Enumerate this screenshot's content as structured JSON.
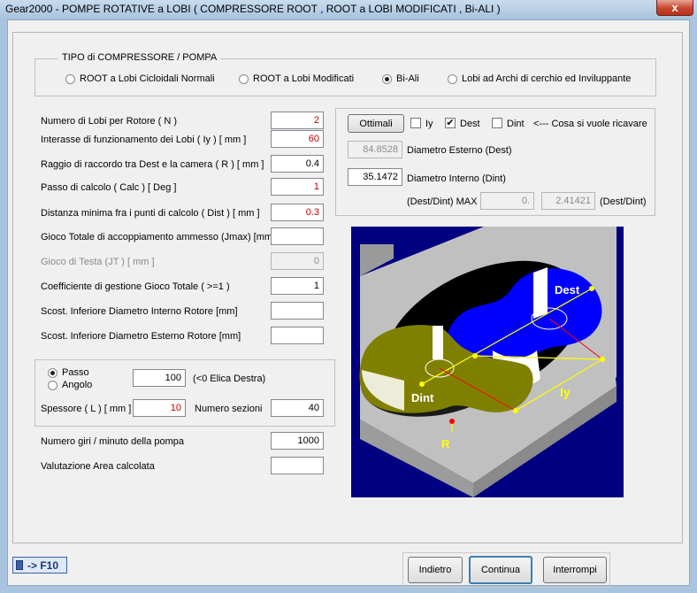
{
  "window": {
    "title": "Gear2000 - POMPE ROTATIVE a LOBI ( COMPRESSORE ROOT , ROOT a LOBI MODIFICATI , Bi-ALI )",
    "close_label": "x"
  },
  "tipo": {
    "label": "TIPO di COMPRESSORE / POMPA",
    "options": [
      "ROOT a Lobi Cicloidali Normali",
      "ROOT a Lobi Modificati",
      "Bi-Ali",
      "Lobi ad Archi di cerchio ed Inviluppante"
    ],
    "selected": "Bi-Ali"
  },
  "params": [
    {
      "label": "Numero di Lobi per Rotore ( N )",
      "value": "2",
      "red": true
    },
    {
      "label": "Interasse di funzionamento dei Lobi ( Iy ) [ mm ]",
      "value": "60",
      "red": true
    },
    {
      "label": "Raggio di raccordo tra Dest e la camera ( R ) [ mm ]",
      "value": "0.4",
      "red": false
    },
    {
      "label": "Passo di calcolo ( Calc ) [ Deg ]",
      "value": "1",
      "red": true
    },
    {
      "label": "Distanza minima fra i punti di calcolo ( Dist ) [ mm ]",
      "value": "0.3",
      "red": true
    },
    {
      "label": "Gioco Totale di accoppiamento ammesso (Jmax) [mm]",
      "value": "",
      "red": false
    },
    {
      "label": "Gioco di Testa  (JT ) [ mm ]",
      "value": "0",
      "red": false,
      "disabled": true
    },
    {
      "label": "Coefficiente di gestione Gioco Totale ( >=1 )",
      "value": "1",
      "red": false
    },
    {
      "label": "Scost. Inferiore Diametro Interno Rotore [mm]",
      "value": "",
      "red": false
    },
    {
      "label": "Scost. Inferiore Diametro Esterno Rotore [mm]",
      "value": "",
      "red": false
    }
  ],
  "ottimali": {
    "button": "Ottimali",
    "checks": [
      {
        "label": "Iy",
        "checked": false
      },
      {
        "label": "Dest",
        "checked": true
      },
      {
        "label": "Dint",
        "checked": false
      }
    ],
    "hint": "<---   Cosa si vuole ricavare",
    "dest_value": "84.8528",
    "dest_label": "Diametro Esterno (Dest)",
    "dint_value": "35.1472",
    "dint_label": "Diametro Interno (Dint)",
    "ratio_label": "(Dest/Dint) MAX",
    "ratio_max": "0.",
    "ratio_value": "2.41421",
    "ratio_unit": "(Dest/Dint)"
  },
  "elica": {
    "opt_passo": "Passo",
    "opt_angolo": "Angolo",
    "selected": "Passo",
    "passo_value": "100",
    "passo_note": "(<0 Elica Destra)",
    "spessore_label": "Spessore ( L ) [ mm ]",
    "spessore_value": "10",
    "sezioni_label": "Numero sezioni",
    "sezioni_value": "40"
  },
  "giri": {
    "label": "Numero giri / minuto della pompa",
    "value": "1000"
  },
  "area": {
    "label": "Valutazione Area calcolata",
    "value": ""
  },
  "calc_badge": "-> F10",
  "buttons": {
    "back": "Indietro",
    "next": "Continua",
    "stop": "Interrompi"
  },
  "diagram": {
    "labels": {
      "dest": "Dest",
      "dint": "Dint",
      "iy": "Iy",
      "r": "R"
    },
    "colors": {
      "bg": "#000080",
      "plate": "#c0c0c0",
      "rotor_a": "#0000ff",
      "rotor_b": "#808000",
      "mark": "#ffff00",
      "axis": "#ff0000"
    }
  }
}
